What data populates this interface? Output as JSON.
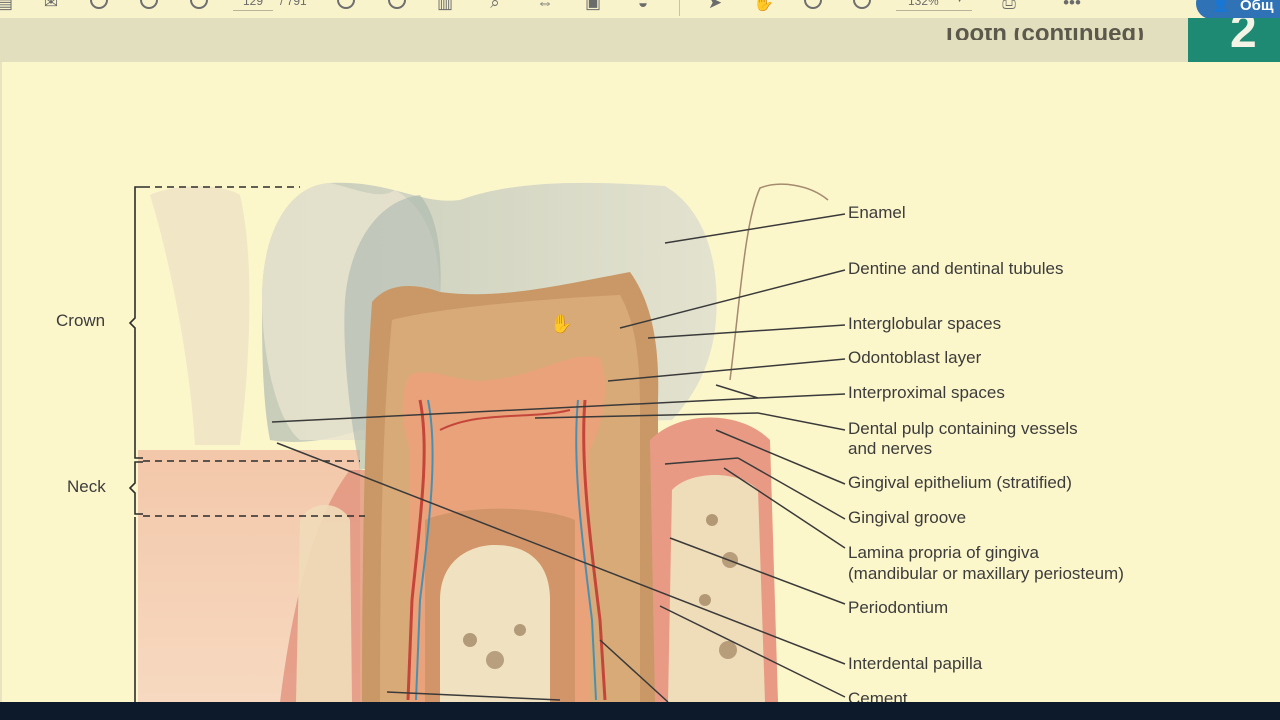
{
  "toolbar": {
    "page_current": "129",
    "page_total": "/ 791",
    "zoom": "132%",
    "share_label": "Общ",
    "icons": [
      "menu-icon",
      "mail-icon",
      "zoom-in-icon",
      "page-up-icon",
      "page-down-icon",
      "search-doc-icon",
      "comment-icon",
      "columns-icon",
      "preview-icon",
      "fit-width-icon",
      "image-icon",
      "eraser-icon",
      "cursor-icon",
      "hand-icon",
      "zoom-out-icon",
      "zoom-plus-icon",
      "save-icon",
      "more-icon",
      "share-user-icon"
    ]
  },
  "header": {
    "chapter_title": "Tooth (continued)",
    "chapter_number": "2",
    "accent_color": "#1f8a73"
  },
  "diagram": {
    "regions": {
      "crown": "Crown",
      "neck": "Neck"
    },
    "labels": [
      "Enamel",
      "Dentine and dentinal tubules",
      "Interglobular spaces",
      "Odontoblast layer",
      "Interproximal spaces",
      "Dental pulp containing vessels",
      "and nerves",
      "Gingival epithelium (stratified)",
      "Gingival groove",
      "Lamina propria of gingiva",
      "(mandibular or maxillary periosteum)",
      "Periodontium",
      "Interdental papilla",
      "Cement"
    ]
  }
}
